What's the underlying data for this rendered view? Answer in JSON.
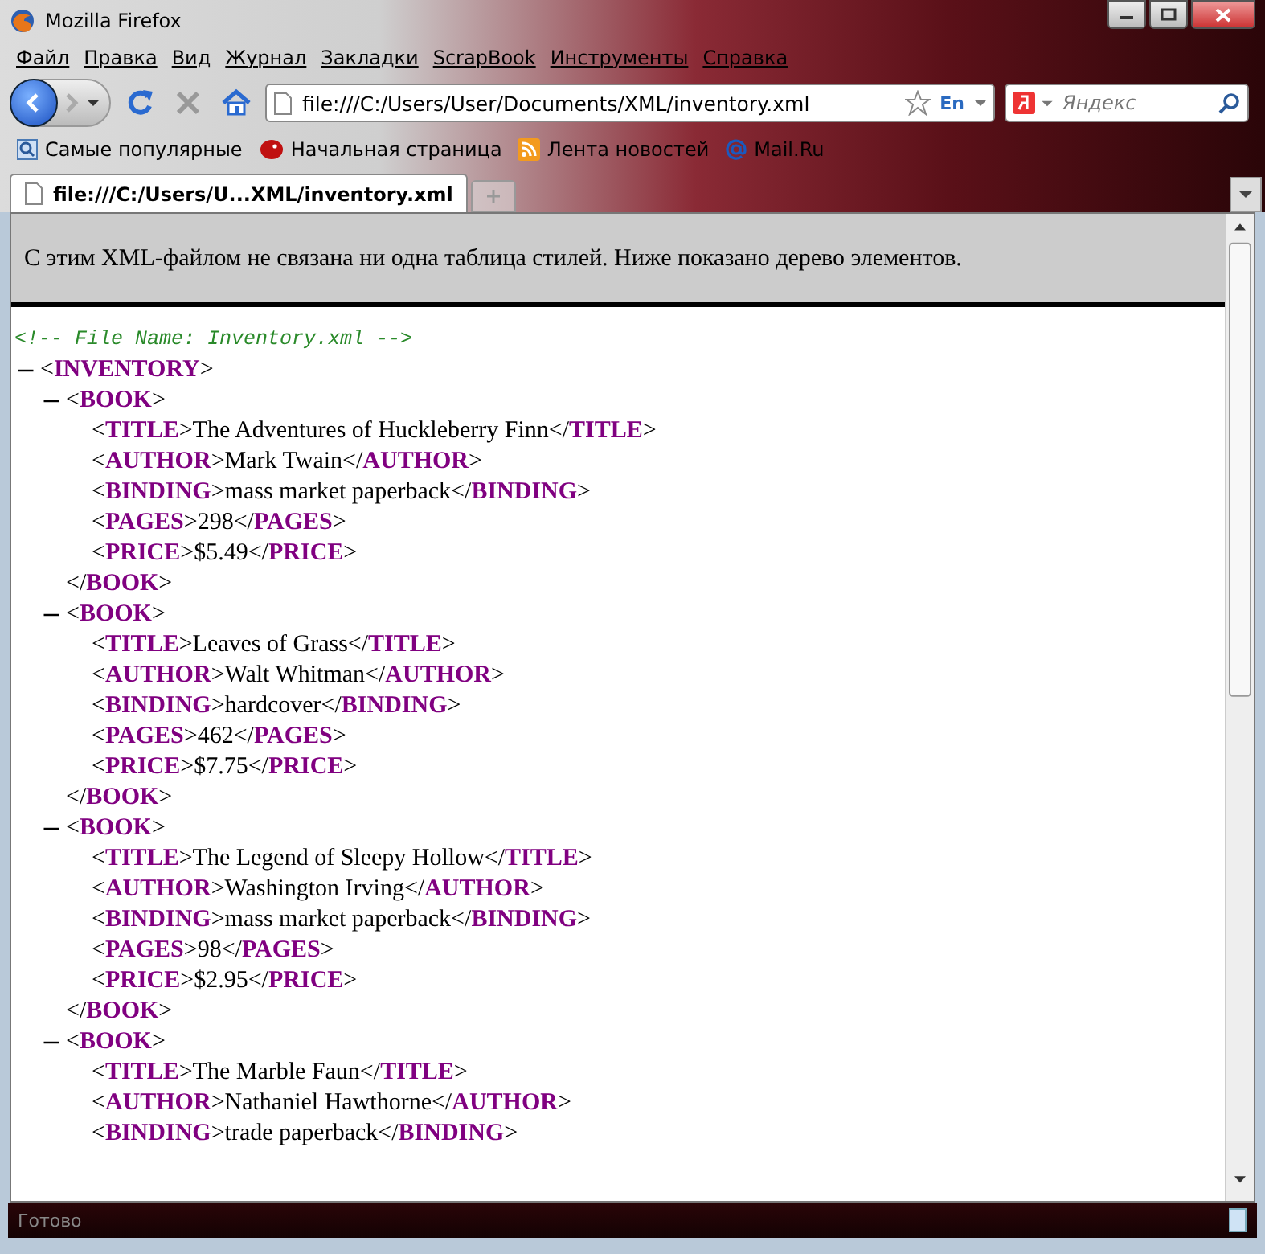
{
  "window": {
    "title": "Mozilla Firefox"
  },
  "menu": [
    "Файл",
    "Правка",
    "Вид",
    "Журнал",
    "Закладки",
    "ScrapBook",
    "Инструменты",
    "Справка"
  ],
  "address_bar": {
    "value": "file:///C:/Users/User/Documents/XML/inventory.xml",
    "language": "En"
  },
  "search": {
    "placeholder": "Яндекс"
  },
  "bookmarks": [
    {
      "label": "Самые популярные",
      "kind": "search"
    },
    {
      "label": "Начальная страница",
      "kind": "start"
    },
    {
      "label": "Лента новостей",
      "kind": "feed"
    },
    {
      "label": "Mail.Ru",
      "kind": "mail"
    }
  ],
  "tabs": [
    {
      "label": "file:///C:/Users/U...XML/inventory.xml",
      "selected": true
    }
  ],
  "info_message": "С этим XML-файлом не связана ни одна таблица стилей. Ниже показано дерево элементов.",
  "comment": "<!-- File Name: Inventory.xml -->",
  "tree": {
    "open": "<**INVENTORY**>",
    "expanded": true,
    "children": [
      {
        "open": "<**BOOK**>",
        "expanded": true,
        "close": "</**BOOK**>",
        "children": [
          {
            "line": "<**TITLE**>The Adventures of Huckleberry Finn</**TITLE**>"
          },
          {
            "line": "<**AUTHOR**>Mark Twain</**AUTHOR**>"
          },
          {
            "line": "<**BINDING**>mass market paperback</**BINDING**>"
          },
          {
            "line": "<**PAGES**>298</**PAGES**>"
          },
          {
            "line": "<**PRICE**>$5.49</**PRICE**>"
          }
        ]
      },
      {
        "open": "<**BOOK**>",
        "expanded": true,
        "close": "</**BOOK**>",
        "children": [
          {
            "line": "<**TITLE**>Leaves of Grass</**TITLE**>"
          },
          {
            "line": "<**AUTHOR**>Walt Whitman</**AUTHOR**>"
          },
          {
            "line": "<**BINDING**>hardcover</**BINDING**>"
          },
          {
            "line": "<**PAGES**>462</**PAGES**>"
          },
          {
            "line": "<**PRICE**>$7.75</**PRICE**>"
          }
        ]
      },
      {
        "open": "<**BOOK**>",
        "expanded": true,
        "close": "</**BOOK**>",
        "children": [
          {
            "line": "<**TITLE**>The Legend of Sleepy Hollow</**TITLE**>"
          },
          {
            "line": "<**AUTHOR**>Washington Irving</**AUTHOR**>"
          },
          {
            "line": "<**BINDING**>mass market paperback</**BINDING**>"
          },
          {
            "line": "<**PAGES**>98</**PAGES**>"
          },
          {
            "line": "<**PRICE**>$2.95</**PRICE**>"
          }
        ]
      },
      {
        "open": "<**BOOK**>",
        "expanded": true,
        "children": [
          {
            "line": "<**TITLE**>The Marble Faun</**TITLE**>"
          },
          {
            "line": "<**AUTHOR**>Nathaniel Hawthorne</**AUTHOR**>"
          },
          {
            "line": "<**BINDING**>trade paperback</**BINDING**>"
          }
        ]
      }
    ]
  },
  "status_bar": {
    "text": "Готово"
  }
}
